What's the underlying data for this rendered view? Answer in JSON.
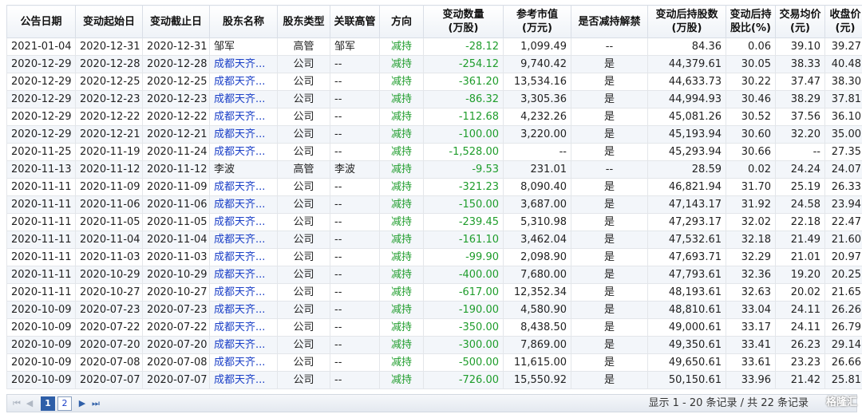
{
  "columns": [
    "公告日期",
    "变动起始日",
    "变动截止日",
    "股东名称",
    "股东类型",
    "关联高管",
    "方向",
    "变动数量\n(万股)",
    "参考市值\n(万元)",
    "是否减持解禁",
    "变动后持股数\n(万股)",
    "变动后持\n股比(%)",
    "交易均价\n(元)",
    "收盘价\n(元)"
  ],
  "rows": [
    [
      "2021-01-04",
      "2020-12-31",
      "2020-12-31",
      "邹军",
      "高管",
      "邹军",
      "减持",
      "-28.12",
      "1,099.49",
      "--",
      "84.36",
      "0.06",
      "39.10",
      "39.27"
    ],
    [
      "2020-12-29",
      "2020-12-28",
      "2020-12-28",
      "成都天齐...",
      "公司",
      "--",
      "减持",
      "-254.12",
      "9,740.42",
      "是",
      "44,379.61",
      "30.05",
      "38.33",
      "40.48"
    ],
    [
      "2020-12-29",
      "2020-12-25",
      "2020-12-25",
      "成都天齐...",
      "公司",
      "--",
      "减持",
      "-361.20",
      "13,534.16",
      "是",
      "44,633.73",
      "30.22",
      "37.47",
      "38.30"
    ],
    [
      "2020-12-29",
      "2020-12-23",
      "2020-12-23",
      "成都天齐...",
      "公司",
      "--",
      "减持",
      "-86.32",
      "3,305.36",
      "是",
      "44,994.93",
      "30.46",
      "38.29",
      "37.81"
    ],
    [
      "2020-12-29",
      "2020-12-22",
      "2020-12-22",
      "成都天齐...",
      "公司",
      "--",
      "减持",
      "-112.68",
      "4,232.26",
      "是",
      "45,081.26",
      "30.52",
      "37.56",
      "36.10"
    ],
    [
      "2020-12-29",
      "2020-12-21",
      "2020-12-21",
      "成都天齐...",
      "公司",
      "--",
      "减持",
      "-100.00",
      "3,220.00",
      "是",
      "45,193.94",
      "30.60",
      "32.20",
      "35.00"
    ],
    [
      "2020-11-25",
      "2020-11-19",
      "2020-11-24",
      "成都天齐...",
      "公司",
      "--",
      "减持",
      "-1,528.00",
      "--",
      "是",
      "45,293.94",
      "30.66",
      "--",
      "27.35"
    ],
    [
      "2020-11-13",
      "2020-11-12",
      "2020-11-12",
      "李波",
      "高管",
      "李波",
      "减持",
      "-9.53",
      "231.01",
      "--",
      "28.59",
      "0.02",
      "24.24",
      "24.07"
    ],
    [
      "2020-11-11",
      "2020-11-09",
      "2020-11-09",
      "成都天齐...",
      "公司",
      "--",
      "减持",
      "-321.23",
      "8,090.40",
      "是",
      "46,821.94",
      "31.70",
      "25.19",
      "26.33"
    ],
    [
      "2020-11-11",
      "2020-11-06",
      "2020-11-06",
      "成都天齐...",
      "公司",
      "--",
      "减持",
      "-150.00",
      "3,687.00",
      "是",
      "47,143.17",
      "31.92",
      "24.58",
      "23.94"
    ],
    [
      "2020-11-11",
      "2020-11-05",
      "2020-11-05",
      "成都天齐...",
      "公司",
      "--",
      "减持",
      "-239.45",
      "5,310.98",
      "是",
      "47,293.17",
      "32.02",
      "22.18",
      "22.47"
    ],
    [
      "2020-11-11",
      "2020-11-04",
      "2020-11-04",
      "成都天齐...",
      "公司",
      "--",
      "减持",
      "-161.10",
      "3,462.04",
      "是",
      "47,532.61",
      "32.18",
      "21.49",
      "21.60"
    ],
    [
      "2020-11-11",
      "2020-11-03",
      "2020-11-03",
      "成都天齐...",
      "公司",
      "--",
      "减持",
      "-99.90",
      "2,098.90",
      "是",
      "47,693.71",
      "32.29",
      "21.01",
      "20.97"
    ],
    [
      "2020-11-11",
      "2020-10-29",
      "2020-10-29",
      "成都天齐...",
      "公司",
      "--",
      "减持",
      "-400.00",
      "7,680.00",
      "是",
      "47,793.61",
      "32.36",
      "19.20",
      "20.25"
    ],
    [
      "2020-11-11",
      "2020-10-27",
      "2020-10-27",
      "成都天齐...",
      "公司",
      "--",
      "减持",
      "-617.00",
      "12,352.34",
      "是",
      "48,193.61",
      "32.63",
      "20.02",
      "21.65"
    ],
    [
      "2020-10-09",
      "2020-07-23",
      "2020-07-23",
      "成都天齐...",
      "公司",
      "--",
      "减持",
      "-190.00",
      "4,580.90",
      "是",
      "48,810.61",
      "33.04",
      "24.11",
      "26.26"
    ],
    [
      "2020-10-09",
      "2020-07-22",
      "2020-07-22",
      "成都天齐...",
      "公司",
      "--",
      "减持",
      "-350.00",
      "8,438.50",
      "是",
      "49,000.61",
      "33.17",
      "24.11",
      "26.79"
    ],
    [
      "2020-10-09",
      "2020-07-20",
      "2020-07-20",
      "成都天齐...",
      "公司",
      "--",
      "减持",
      "-300.00",
      "7,869.00",
      "是",
      "49,350.61",
      "33.41",
      "26.23",
      "29.14"
    ],
    [
      "2020-10-09",
      "2020-07-08",
      "2020-07-08",
      "成都天齐...",
      "公司",
      "--",
      "减持",
      "-500.00",
      "11,615.00",
      "是",
      "49,650.61",
      "33.61",
      "23.23",
      "26.66"
    ],
    [
      "2020-10-09",
      "2020-07-07",
      "2020-07-07",
      "成都天齐...",
      "公司",
      "--",
      "减持",
      "-726.00",
      "15,550.92",
      "是",
      "50,150.61",
      "33.96",
      "21.42",
      "25.81"
    ]
  ],
  "pager": {
    "first": "⏮",
    "prev": "◀",
    "pages": [
      "1",
      "2"
    ],
    "active_page": "1",
    "next": "▶",
    "last": "⏭",
    "info": "显示 1 - 20 条记录 / 共 22 条记录"
  },
  "watermark": "格隆汇",
  "colors": {
    "decrease": "#1f9d2c",
    "link": "#1a3fc7",
    "row_alt": "#f3f6fa",
    "header_border": "#d9dee6"
  }
}
